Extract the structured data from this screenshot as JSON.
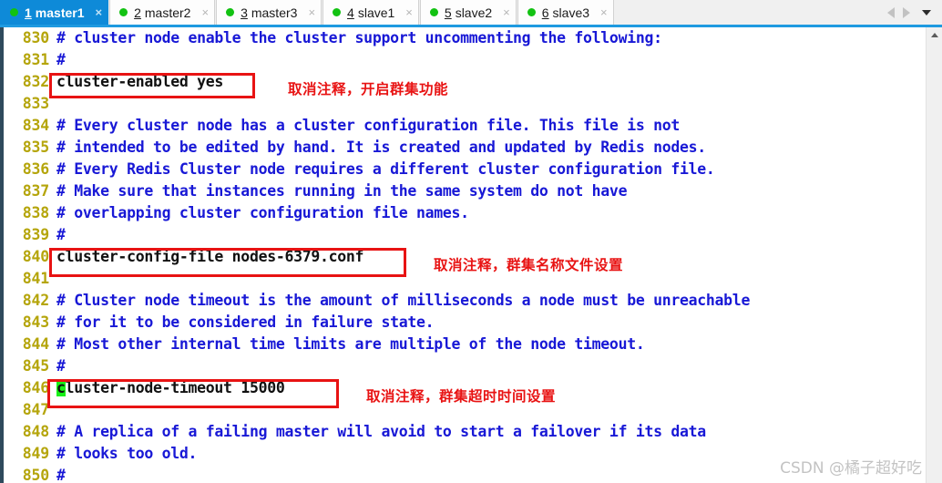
{
  "tabbar": {
    "tabs": [
      {
        "num": "1",
        "label": "master1",
        "active": true,
        "close": "×",
        "dot_color": "#12c212"
      },
      {
        "num": "2",
        "label": "master2",
        "active": false,
        "close": "×",
        "dot_color": "#12c212"
      },
      {
        "num": "3",
        "label": "master3",
        "active": false,
        "close": "×",
        "dot_color": "#12c212"
      },
      {
        "num": "4",
        "label": "slave1",
        "active": false,
        "close": "×",
        "dot_color": "#12c212"
      },
      {
        "num": "5",
        "label": "slave2",
        "active": false,
        "close": "×",
        "dot_color": "#12c212"
      },
      {
        "num": "6",
        "label": "slave3",
        "active": false,
        "close": "×",
        "dot_color": "#12c212"
      }
    ],
    "nav": {
      "prev_icon": "triangle-left-icon",
      "next_icon": "triangle-right-icon",
      "menu_icon": "chevron-down-icon"
    },
    "active_tab_color": "#0e8ad8",
    "accent_underline_color": "#1e9ae0"
  },
  "editor": {
    "lines": [
      {
        "n": "830",
        "text": "# cluster node enable the cluster support uncommenting the following:",
        "kind": "comment"
      },
      {
        "n": "831",
        "text": "#",
        "kind": "comment"
      },
      {
        "n": "832",
        "text": "cluster-enabled yes",
        "kind": "config"
      },
      {
        "n": "833",
        "text": "",
        "kind": "comment"
      },
      {
        "n": "834",
        "text": "# Every cluster node has a cluster configuration file. This file is not",
        "kind": "comment"
      },
      {
        "n": "835",
        "text": "# intended to be edited by hand. It is created and updated by Redis nodes.",
        "kind": "comment"
      },
      {
        "n": "836",
        "text": "# Every Redis Cluster node requires a different cluster configuration file.",
        "kind": "comment"
      },
      {
        "n": "837",
        "text": "# Make sure that instances running in the same system do not have",
        "kind": "comment"
      },
      {
        "n": "838",
        "text": "# overlapping cluster configuration file names.",
        "kind": "comment"
      },
      {
        "n": "839",
        "text": "#",
        "kind": "comment"
      },
      {
        "n": "840",
        "text": "cluster-config-file nodes-6379.conf",
        "kind": "config"
      },
      {
        "n": "841",
        "text": "",
        "kind": "comment"
      },
      {
        "n": "842",
        "text": "# Cluster node timeout is the amount of milliseconds a node must be unreachable",
        "kind": "comment"
      },
      {
        "n": "843",
        "text": "# for it to be considered in failure state.",
        "kind": "comment"
      },
      {
        "n": "844",
        "text": "# Most other internal time limits are multiple of the node timeout.",
        "kind": "comment"
      },
      {
        "n": "845",
        "text": "#",
        "kind": "comment"
      },
      {
        "n": "846",
        "text": "cluster-node-timeout 15000",
        "kind": "config",
        "cursor_char": "c"
      },
      {
        "n": "847",
        "text": "",
        "kind": "comment"
      },
      {
        "n": "848",
        "text": "# A replica of a failing master will avoid to start a failover if its data",
        "kind": "comment"
      },
      {
        "n": "849",
        "text": "# looks too old.",
        "kind": "comment"
      },
      {
        "n": "850",
        "text": "#",
        "kind": "comment"
      }
    ],
    "comment_color": "#1818d6",
    "config_color": "#111111",
    "linenumber_color": "#b5a50b",
    "cursor_color": "#18f018"
  },
  "annotations": [
    {
      "text": "取消注释，开启群集功能",
      "color": "#e81313"
    },
    {
      "text": "取消注释，群集名称文件设置",
      "color": "#e81313"
    },
    {
      "text": "取消注释，群集超时时间设置",
      "color": "#e81313"
    }
  ],
  "scrollbar": {
    "up_arrow_icon": "caret-up-icon"
  },
  "watermark": {
    "text": "CSDN @橘子超好吃"
  }
}
